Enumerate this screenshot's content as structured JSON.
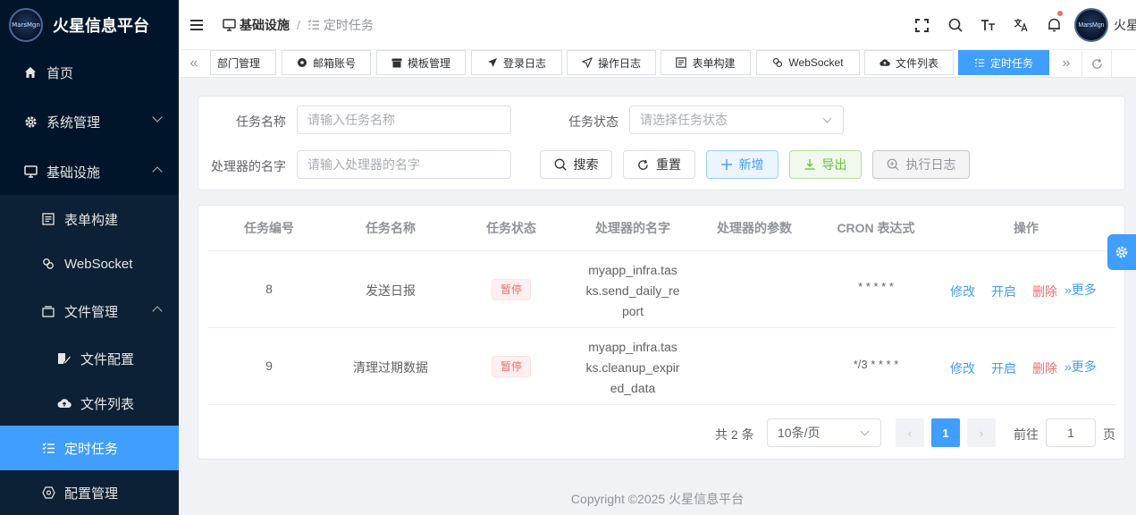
{
  "app": {
    "title": "火星信息平台",
    "logo_text": "MarsMgn"
  },
  "sidebar": {
    "items": [
      {
        "label": "首页",
        "icon": "home-icon"
      },
      {
        "label": "系统管理",
        "icon": "gear-icon"
      },
      {
        "label": "基础设施",
        "icon": "monitor-icon"
      },
      {
        "label": "表单构建",
        "icon": "form-icon"
      },
      {
        "label": "WebSocket",
        "icon": "link-icon"
      },
      {
        "label": "文件管理",
        "icon": "folder-icon"
      },
      {
        "label": "文件配置",
        "icon": "file-edit-icon"
      },
      {
        "label": "文件列表",
        "icon": "cloud-upload-icon"
      },
      {
        "label": "定时任务",
        "icon": "task-list-icon"
      },
      {
        "label": "配置管理",
        "icon": "config-icon"
      }
    ]
  },
  "header": {
    "breadcrumb": [
      "基础设施",
      "定时任务"
    ],
    "user_name": "火星"
  },
  "tabs": [
    {
      "label": "部门管理"
    },
    {
      "label": "邮箱账号"
    },
    {
      "label": "模板管理"
    },
    {
      "label": "登录日志"
    },
    {
      "label": "操作日志"
    },
    {
      "label": "表单构建"
    },
    {
      "label": "WebSocket"
    },
    {
      "label": "文件列表"
    },
    {
      "label": "定时任务"
    }
  ],
  "search": {
    "task_name_label": "任务名称",
    "task_name_placeholder": "请输入任务名称",
    "task_status_label": "任务状态",
    "task_status_placeholder": "请选择任务状态",
    "handler_label": "处理器的名字",
    "handler_placeholder": "请输入处理器的名字",
    "btn_search": "搜索",
    "btn_reset": "重置",
    "btn_add": "新增",
    "btn_export": "导出",
    "btn_log": "执行日志"
  },
  "table": {
    "columns": [
      "任务编号",
      "任务名称",
      "任务状态",
      "处理器的名字",
      "处理器的参数",
      "CRON 表达式",
      "操作"
    ],
    "rows": [
      {
        "id": "8",
        "name": "发送日报",
        "status": "暂停",
        "handler_l1": "myapp_infra.tas",
        "handler_l2": "ks.send_daily_re",
        "handler_l3": "port",
        "param": "",
        "cron": "* * * * *"
      },
      {
        "id": "9",
        "name": "清理过期数据",
        "status": "暂停",
        "handler_l1": "myapp_infra.tas",
        "handler_l2": "ks.cleanup_expir",
        "handler_l3": "ed_data",
        "param": "",
        "cron": "*/3 * * * *"
      }
    ],
    "actions": {
      "edit": "修改",
      "start": "开启",
      "delete": "删除",
      "more": "更多"
    }
  },
  "pagination": {
    "total": "共 2 条",
    "page_size": "10条/页",
    "current": "1",
    "goto_label": "前往",
    "goto_value": "1",
    "page_suffix": "页"
  },
  "footer": {
    "copyright": "Copyright ©2025 火星信息平台"
  }
}
